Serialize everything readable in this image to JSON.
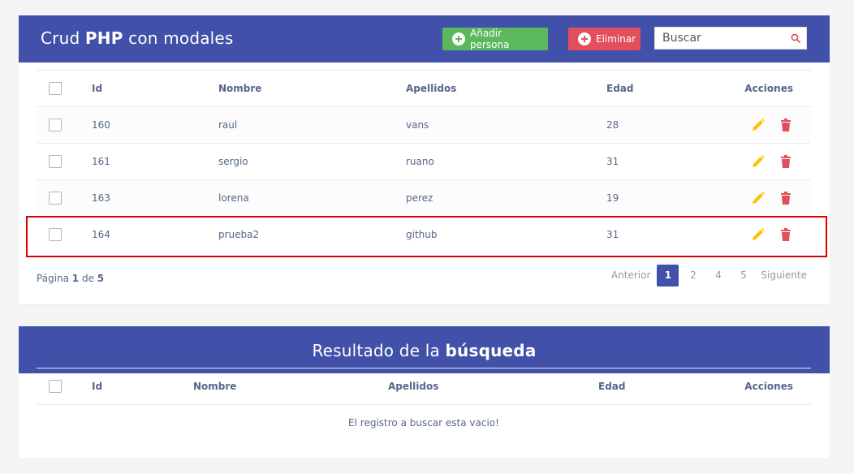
{
  "main": {
    "title_pre": "Crud ",
    "title_bold": "PHP",
    "title_post": " con modales",
    "add_label": "Añadir persona",
    "delete_label": "Eliminar",
    "search_placeholder": "Buscar",
    "columns": [
      "Id",
      "Nombre",
      "Apellidos",
      "Edad",
      "Acciones"
    ],
    "rows": [
      {
        "id": "160",
        "nombre": "raul",
        "apellidos": "vans",
        "edad": "28"
      },
      {
        "id": "161",
        "nombre": "sergio",
        "apellidos": "ruano",
        "edad": "31"
      },
      {
        "id": "163",
        "nombre": "lorena",
        "apellidos": "perez",
        "edad": "19"
      },
      {
        "id": "164",
        "nombre": "prueba2",
        "apellidos": "github",
        "edad": "31"
      }
    ],
    "hint_pre": "Página ",
    "hint_current": "1",
    "hint_mid": " de ",
    "hint_total": "5",
    "pagination": {
      "prev": "Anterior",
      "pages": [
        "1",
        "2",
        "4",
        "5"
      ],
      "next": "Siguiente"
    }
  },
  "results": {
    "title_pre": "Resultado de la ",
    "title_bold": "búsqueda",
    "columns": [
      "Id",
      "Nombre",
      "Apellidos",
      "Edad",
      "Acciones"
    ],
    "empty_message": "El registro a buscar esta vacio!"
  },
  "colors": {
    "header": "#4150a8",
    "add": "#5cb85c",
    "delete": "#e34e5d",
    "edit_icon": "#ffc107",
    "trash_icon": "#e34e5d",
    "highlight": "#e00000"
  }
}
